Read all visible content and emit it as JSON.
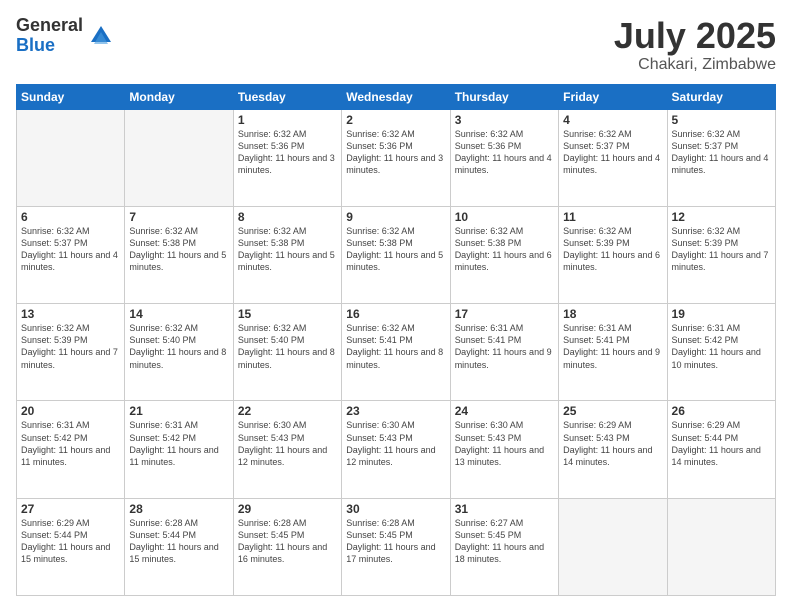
{
  "logo": {
    "general": "General",
    "blue": "Blue"
  },
  "title": {
    "month": "July 2025",
    "location": "Chakari, Zimbabwe"
  },
  "days_header": [
    "Sunday",
    "Monday",
    "Tuesday",
    "Wednesday",
    "Thursday",
    "Friday",
    "Saturday"
  ],
  "weeks": [
    [
      {
        "num": "",
        "info": "",
        "empty": true
      },
      {
        "num": "",
        "info": "",
        "empty": true
      },
      {
        "num": "1",
        "info": "Sunrise: 6:32 AM\nSunset: 5:36 PM\nDaylight: 11 hours and 3 minutes."
      },
      {
        "num": "2",
        "info": "Sunrise: 6:32 AM\nSunset: 5:36 PM\nDaylight: 11 hours and 3 minutes."
      },
      {
        "num": "3",
        "info": "Sunrise: 6:32 AM\nSunset: 5:36 PM\nDaylight: 11 hours and 4 minutes."
      },
      {
        "num": "4",
        "info": "Sunrise: 6:32 AM\nSunset: 5:37 PM\nDaylight: 11 hours and 4 minutes."
      },
      {
        "num": "5",
        "info": "Sunrise: 6:32 AM\nSunset: 5:37 PM\nDaylight: 11 hours and 4 minutes."
      }
    ],
    [
      {
        "num": "6",
        "info": "Sunrise: 6:32 AM\nSunset: 5:37 PM\nDaylight: 11 hours and 4 minutes."
      },
      {
        "num": "7",
        "info": "Sunrise: 6:32 AM\nSunset: 5:38 PM\nDaylight: 11 hours and 5 minutes."
      },
      {
        "num": "8",
        "info": "Sunrise: 6:32 AM\nSunset: 5:38 PM\nDaylight: 11 hours and 5 minutes."
      },
      {
        "num": "9",
        "info": "Sunrise: 6:32 AM\nSunset: 5:38 PM\nDaylight: 11 hours and 5 minutes."
      },
      {
        "num": "10",
        "info": "Sunrise: 6:32 AM\nSunset: 5:38 PM\nDaylight: 11 hours and 6 minutes."
      },
      {
        "num": "11",
        "info": "Sunrise: 6:32 AM\nSunset: 5:39 PM\nDaylight: 11 hours and 6 minutes."
      },
      {
        "num": "12",
        "info": "Sunrise: 6:32 AM\nSunset: 5:39 PM\nDaylight: 11 hours and 7 minutes."
      }
    ],
    [
      {
        "num": "13",
        "info": "Sunrise: 6:32 AM\nSunset: 5:39 PM\nDaylight: 11 hours and 7 minutes."
      },
      {
        "num": "14",
        "info": "Sunrise: 6:32 AM\nSunset: 5:40 PM\nDaylight: 11 hours and 8 minutes."
      },
      {
        "num": "15",
        "info": "Sunrise: 6:32 AM\nSunset: 5:40 PM\nDaylight: 11 hours and 8 minutes."
      },
      {
        "num": "16",
        "info": "Sunrise: 6:32 AM\nSunset: 5:41 PM\nDaylight: 11 hours and 8 minutes."
      },
      {
        "num": "17",
        "info": "Sunrise: 6:31 AM\nSunset: 5:41 PM\nDaylight: 11 hours and 9 minutes."
      },
      {
        "num": "18",
        "info": "Sunrise: 6:31 AM\nSunset: 5:41 PM\nDaylight: 11 hours and 9 minutes."
      },
      {
        "num": "19",
        "info": "Sunrise: 6:31 AM\nSunset: 5:42 PM\nDaylight: 11 hours and 10 minutes."
      }
    ],
    [
      {
        "num": "20",
        "info": "Sunrise: 6:31 AM\nSunset: 5:42 PM\nDaylight: 11 hours and 11 minutes."
      },
      {
        "num": "21",
        "info": "Sunrise: 6:31 AM\nSunset: 5:42 PM\nDaylight: 11 hours and 11 minutes."
      },
      {
        "num": "22",
        "info": "Sunrise: 6:30 AM\nSunset: 5:43 PM\nDaylight: 11 hours and 12 minutes."
      },
      {
        "num": "23",
        "info": "Sunrise: 6:30 AM\nSunset: 5:43 PM\nDaylight: 11 hours and 12 minutes."
      },
      {
        "num": "24",
        "info": "Sunrise: 6:30 AM\nSunset: 5:43 PM\nDaylight: 11 hours and 13 minutes."
      },
      {
        "num": "25",
        "info": "Sunrise: 6:29 AM\nSunset: 5:43 PM\nDaylight: 11 hours and 14 minutes."
      },
      {
        "num": "26",
        "info": "Sunrise: 6:29 AM\nSunset: 5:44 PM\nDaylight: 11 hours and 14 minutes."
      }
    ],
    [
      {
        "num": "27",
        "info": "Sunrise: 6:29 AM\nSunset: 5:44 PM\nDaylight: 11 hours and 15 minutes."
      },
      {
        "num": "28",
        "info": "Sunrise: 6:28 AM\nSunset: 5:44 PM\nDaylight: 11 hours and 15 minutes."
      },
      {
        "num": "29",
        "info": "Sunrise: 6:28 AM\nSunset: 5:45 PM\nDaylight: 11 hours and 16 minutes."
      },
      {
        "num": "30",
        "info": "Sunrise: 6:28 AM\nSunset: 5:45 PM\nDaylight: 11 hours and 17 minutes."
      },
      {
        "num": "31",
        "info": "Sunrise: 6:27 AM\nSunset: 5:45 PM\nDaylight: 11 hours and 18 minutes."
      },
      {
        "num": "",
        "info": "",
        "empty": true
      },
      {
        "num": "",
        "info": "",
        "empty": true
      }
    ]
  ]
}
